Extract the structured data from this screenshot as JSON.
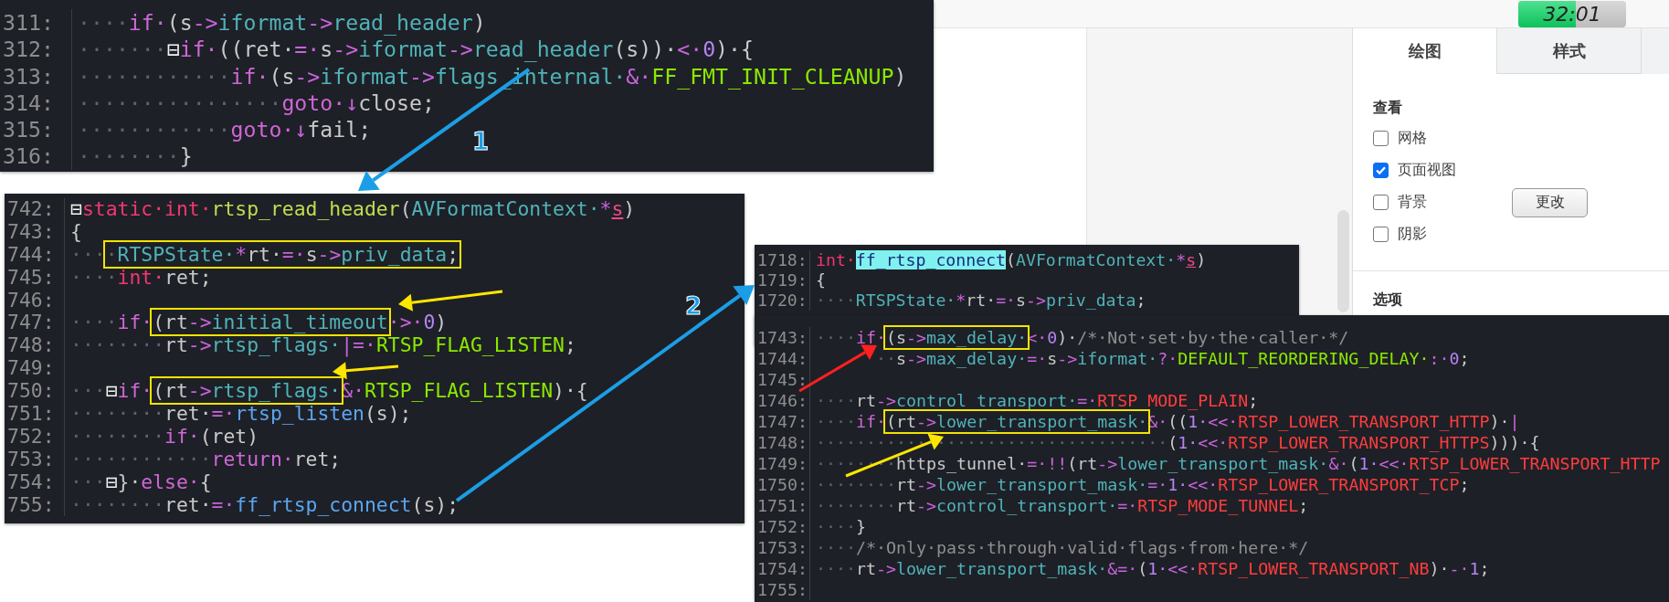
{
  "snippets": [
    {
      "lines": [
        {
          "number": "311:",
          "tokens": [
            {
              "kind": "ws",
              "text": "····"
            },
            {
              "kind": "keyword",
              "text": "if·"
            },
            {
              "kind": "plain",
              "text": "(s"
            },
            {
              "kind": "op",
              "text": "->"
            },
            {
              "kind": "member",
              "text": "iformat"
            },
            {
              "kind": "op",
              "text": "->"
            },
            {
              "kind": "member",
              "text": "read_header"
            },
            {
              "kind": "plain",
              "text": ")"
            }
          ]
        },
        {
          "number": "312:",
          "tokens": [
            {
              "kind": "ws",
              "text": "·······"
            },
            {
              "kind": "fold",
              "text": "⊟"
            },
            {
              "kind": "keyword",
              "text": "if·"
            },
            {
              "kind": "plain",
              "text": "((ret·"
            },
            {
              "kind": "op",
              "text": "=·"
            },
            {
              "kind": "plain",
              "text": "s"
            },
            {
              "kind": "op",
              "text": "->"
            },
            {
              "kind": "member",
              "text": "iformat"
            },
            {
              "kind": "op",
              "text": "->"
            },
            {
              "kind": "member",
              "text": "read_header"
            },
            {
              "kind": "plain",
              "text": "(s))·"
            },
            {
              "kind": "op",
              "text": "<·"
            },
            {
              "kind": "num",
              "text": "0"
            },
            {
              "kind": "plain",
              "text": ")·{"
            }
          ]
        },
        {
          "number": "313:",
          "tokens": [
            {
              "kind": "ws",
              "text": "············"
            },
            {
              "kind": "keyword",
              "text": "if·"
            },
            {
              "kind": "plain",
              "text": "(s"
            },
            {
              "kind": "op",
              "text": "->"
            },
            {
              "kind": "member",
              "text": "iformat"
            },
            {
              "kind": "op",
              "text": "->"
            },
            {
              "kind": "member",
              "text": "flags_internal·"
            },
            {
              "kind": "op",
              "text": "&·"
            },
            {
              "kind": "macro",
              "text": "FF_FMT_INIT_CLEANUP"
            },
            {
              "kind": "plain",
              "text": ")"
            }
          ]
        },
        {
          "number": "314:",
          "tokens": [
            {
              "kind": "ws",
              "text": "················"
            },
            {
              "kind": "keyword",
              "text": "goto·"
            },
            {
              "kind": "op",
              "text": "↓"
            },
            {
              "kind": "plain",
              "text": "close;"
            }
          ]
        },
        {
          "number": "315:",
          "tokens": [
            {
              "kind": "ws",
              "text": "············"
            },
            {
              "kind": "keyword",
              "text": "goto·"
            },
            {
              "kind": "op",
              "text": "↓"
            },
            {
              "kind": "plain",
              "text": "fail;"
            }
          ]
        },
        {
          "number": "316:",
          "tokens": [
            {
              "kind": "ws",
              "text": "········"
            },
            {
              "kind": "plain",
              "text": "}"
            }
          ]
        }
      ]
    },
    {
      "lines": [
        {
          "number": "742:",
          "tokens": [
            {
              "kind": "fold",
              "text": "⊟"
            },
            {
              "kind": "type",
              "text": "static·"
            },
            {
              "kind": "type",
              "text": "int·"
            },
            {
              "kind": "def",
              "text": "rtsp_read_header"
            },
            {
              "kind": "plain",
              "text": "("
            },
            {
              "kind": "member",
              "text": "AVFormatContext·"
            },
            {
              "kind": "op",
              "text": "*"
            },
            {
              "kind": "param",
              "text": "s"
            },
            {
              "kind": "plain",
              "text": ")"
            }
          ]
        },
        {
          "number": "743:",
          "tokens": [
            {
              "kind": "plain",
              "text": "{"
            }
          ]
        },
        {
          "number": "744:",
          "tokens": [
            {
              "kind": "ws",
              "text": "···"
            },
            {
              "kind": "box",
              "children": [
                {
                  "kind": "ws",
                  "text": "·"
                },
                {
                  "kind": "member",
                  "text": "RTSPState·"
                },
                {
                  "kind": "op",
                  "text": "*"
                },
                {
                  "kind": "plain",
                  "text": "rt·"
                },
                {
                  "kind": "op",
                  "text": "=·"
                },
                {
                  "kind": "plain",
                  "text": "s"
                },
                {
                  "kind": "op",
                  "text": "->"
                },
                {
                  "kind": "member",
                  "text": "priv_data"
                },
                {
                  "kind": "plain",
                  "text": ";"
                }
              ]
            }
          ]
        },
        {
          "number": "745:",
          "tokens": [
            {
              "kind": "ws",
              "text": "····"
            },
            {
              "kind": "type",
              "text": "int·"
            },
            {
              "kind": "plain",
              "text": "ret;"
            }
          ]
        },
        {
          "number": "746:"
        },
        {
          "number": "747:",
          "tokens": [
            {
              "kind": "ws",
              "text": "····"
            },
            {
              "kind": "keyword",
              "text": "if·"
            },
            {
              "kind": "box",
              "children": [
                {
                  "kind": "plain",
                  "text": "(rt"
                },
                {
                  "kind": "op",
                  "text": "->"
                },
                {
                  "kind": "member",
                  "text": "initial_timeout"
                }
              ]
            },
            {
              "kind": "op",
              "text": "·>·"
            },
            {
              "kind": "num",
              "text": "0"
            },
            {
              "kind": "plain",
              "text": ")"
            }
          ]
        },
        {
          "number": "748:",
          "tokens": [
            {
              "kind": "ws",
              "text": "········"
            },
            {
              "kind": "plain",
              "text": "rt"
            },
            {
              "kind": "op",
              "text": "->"
            },
            {
              "kind": "member",
              "text": "rtsp_flags·"
            },
            {
              "kind": "op",
              "text": "|=·"
            },
            {
              "kind": "macro",
              "text": "RTSP_FLAG_LISTEN"
            },
            {
              "kind": "plain",
              "text": ";"
            }
          ]
        },
        {
          "number": "749:"
        },
        {
          "number": "750:",
          "tokens": [
            {
              "kind": "ws",
              "text": "···"
            },
            {
              "kind": "fold",
              "text": "⊟"
            },
            {
              "kind": "keyword",
              "text": "if·"
            },
            {
              "kind": "box",
              "children": [
                {
                  "kind": "plain",
                  "text": "(rt"
                },
                {
                  "kind": "op",
                  "text": "->"
                },
                {
                  "kind": "member",
                  "text": "rtsp_flags·"
                }
              ]
            },
            {
              "kind": "op",
              "text": "&·"
            },
            {
              "kind": "macro",
              "text": "RTSP_FLAG_LISTEN"
            },
            {
              "kind": "plain",
              "text": ")·{"
            }
          ]
        },
        {
          "number": "751:",
          "tokens": [
            {
              "kind": "ws",
              "text": "········"
            },
            {
              "kind": "plain",
              "text": "ret·"
            },
            {
              "kind": "op",
              "text": "=·"
            },
            {
              "kind": "func",
              "text": "rtsp_listen"
            },
            {
              "kind": "plain",
              "text": "(s);"
            }
          ]
        },
        {
          "number": "752:",
          "tokens": [
            {
              "kind": "ws",
              "text": "········"
            },
            {
              "kind": "keyword",
              "text": "if·"
            },
            {
              "kind": "plain",
              "text": "(ret)"
            }
          ]
        },
        {
          "number": "753:",
          "tokens": [
            {
              "kind": "ws",
              "text": "············"
            },
            {
              "kind": "keyword",
              "text": "return·"
            },
            {
              "kind": "plain",
              "text": "ret;"
            }
          ]
        },
        {
          "number": "754:",
          "tokens": [
            {
              "kind": "ws",
              "text": "···"
            },
            {
              "kind": "fold",
              "text": "⊟"
            },
            {
              "kind": "plain",
              "text": "}·"
            },
            {
              "kind": "keyword",
              "text": "else·"
            },
            {
              "kind": "plain",
              "text": "{"
            }
          ]
        },
        {
          "number": "755:",
          "tokens": [
            {
              "kind": "ws",
              "text": "········"
            },
            {
              "kind": "plain",
              "text": "ret·"
            },
            {
              "kind": "op",
              "text": "=·"
            },
            {
              "kind": "func",
              "text": "ff_rtsp_connect"
            },
            {
              "kind": "plain",
              "text": "(s);"
            }
          ]
        }
      ]
    },
    {
      "lines": [
        {
          "number": "1718:",
          "tokens": [
            {
              "kind": "type",
              "text": "int·"
            },
            {
              "kind": "mark",
              "text": "ff_rtsp_connect"
            },
            {
              "kind": "plain",
              "text": "("
            },
            {
              "kind": "member",
              "text": "AVFormatContext·"
            },
            {
              "kind": "op",
              "text": "*"
            },
            {
              "kind": "param",
              "text": "s"
            },
            {
              "kind": "plain",
              "text": ")"
            }
          ]
        },
        {
          "number": "1719:",
          "tokens": [
            {
              "kind": "plain",
              "text": "{"
            }
          ]
        },
        {
          "number": "1720:",
          "tokens": [
            {
              "kind": "ws",
              "text": "····"
            },
            {
              "kind": "member",
              "text": "RTSPState·"
            },
            {
              "kind": "op",
              "text": "*"
            },
            {
              "kind": "plain",
              "text": "rt·"
            },
            {
              "kind": "op",
              "text": "=·"
            },
            {
              "kind": "plain",
              "text": "s"
            },
            {
              "kind": "op",
              "text": "->"
            },
            {
              "kind": "member",
              "text": "priv_data"
            },
            {
              "kind": "plain",
              "text": ";"
            }
          ]
        }
      ]
    },
    {
      "lines": [
        {
          "number": "1743:",
          "tokens": [
            {
              "kind": "ws",
              "text": "····"
            },
            {
              "kind": "keyword",
              "text": "if·"
            },
            {
              "kind": "box",
              "children": [
                {
                  "kind": "plain",
                  "text": "(s"
                },
                {
                  "kind": "op",
                  "text": "->"
                },
                {
                  "kind": "member",
                  "text": "max_delay·"
                }
              ]
            },
            {
              "kind": "op",
              "text": "<·"
            },
            {
              "kind": "num",
              "text": "0"
            },
            {
              "kind": "plain",
              "text": ")·"
            },
            {
              "kind": "comment",
              "text": "/*·Not·set·by·the·caller·*/"
            }
          ]
        },
        {
          "number": "1744:",
          "tokens": [
            {
              "kind": "indent"
            },
            {
              "kind": "ws",
              "text": "··"
            },
            {
              "kind": "plain",
              "text": "s"
            },
            {
              "kind": "op",
              "text": "->"
            },
            {
              "kind": "member",
              "text": "max_delay·"
            },
            {
              "kind": "op",
              "text": "=·"
            },
            {
              "kind": "plain",
              "text": "s"
            },
            {
              "kind": "op",
              "text": "->"
            },
            {
              "kind": "member",
              "text": "iformat·"
            },
            {
              "kind": "op",
              "text": "?·"
            },
            {
              "kind": "macro",
              "text": "DEFAULT_REORDERING_DELAY·"
            },
            {
              "kind": "op",
              "text": ":·"
            },
            {
              "kind": "num",
              "text": "0"
            },
            {
              "kind": "plain",
              "text": ";"
            }
          ]
        },
        {
          "number": "1745:"
        },
        {
          "number": "1746:",
          "tokens": [
            {
              "kind": "ws",
              "text": "····"
            },
            {
              "kind": "plain",
              "text": "rt"
            },
            {
              "kind": "op",
              "text": "->"
            },
            {
              "kind": "member",
              "text": "control_transport·"
            },
            {
              "kind": "op",
              "text": "=·"
            },
            {
              "kind": "const",
              "text": "RTSP_MODE_PLAIN"
            },
            {
              "kind": "plain",
              "text": ";"
            }
          ]
        },
        {
          "number": "1747:",
          "tokens": [
            {
              "kind": "ws",
              "text": "····"
            },
            {
              "kind": "keyword",
              "text": "if·"
            },
            {
              "kind": "box",
              "children": [
                {
                  "kind": "plain",
                  "text": "(rt"
                },
                {
                  "kind": "op",
                  "text": "->"
                },
                {
                  "kind": "member",
                  "text": "lower_transport_mask·"
                }
              ]
            },
            {
              "kind": "op",
              "text": "&·"
            },
            {
              "kind": "plain",
              "text": "(("
            },
            {
              "kind": "num",
              "text": "1·"
            },
            {
              "kind": "op",
              "text": "<<·"
            },
            {
              "kind": "const",
              "text": "RTSP_LOWER_TRANSPORT_HTTP"
            },
            {
              "kind": "plain",
              "text": ")·"
            },
            {
              "kind": "op",
              "text": "|"
            }
          ]
        },
        {
          "number": "1748:",
          "tokens": [
            {
              "kind": "ws",
              "text": "···································"
            },
            {
              "kind": "plain",
              "text": "("
            },
            {
              "kind": "num",
              "text": "1·"
            },
            {
              "kind": "op",
              "text": "<<·"
            },
            {
              "kind": "const",
              "text": "RTSP_LOWER_TRANSPORT_HTTPS"
            },
            {
              "kind": "plain",
              "text": ")))·{"
            }
          ]
        },
        {
          "number": "1749:",
          "tokens": [
            {
              "kind": "ws",
              "text": "········"
            },
            {
              "kind": "plain",
              "text": "https_tunnel·"
            },
            {
              "kind": "op",
              "text": "=·!!"
            },
            {
              "kind": "plain",
              "text": "(rt"
            },
            {
              "kind": "op",
              "text": "->"
            },
            {
              "kind": "member",
              "text": "lower_transport_mask·"
            },
            {
              "kind": "op",
              "text": "&·"
            },
            {
              "kind": "plain",
              "text": "("
            },
            {
              "kind": "num",
              "text": "1·"
            },
            {
              "kind": "op",
              "text": "<<·"
            },
            {
              "kind": "const",
              "text": "RTSP_LOWER_TRANSPORT_HTTP"
            }
          ]
        },
        {
          "number": "1750:",
          "tokens": [
            {
              "kind": "ws",
              "text": "········"
            },
            {
              "kind": "plain",
              "text": "rt"
            },
            {
              "kind": "op",
              "text": "->"
            },
            {
              "kind": "member",
              "text": "lower_transport_mask·"
            },
            {
              "kind": "op",
              "text": "=·"
            },
            {
              "kind": "num",
              "text": "1·"
            },
            {
              "kind": "op",
              "text": "<<·"
            },
            {
              "kind": "const",
              "text": "RTSP_LOWER_TRANSPORT_TCP"
            },
            {
              "kind": "plain",
              "text": ";"
            }
          ]
        },
        {
          "number": "1751:",
          "tokens": [
            {
              "kind": "ws",
              "text": "········"
            },
            {
              "kind": "plain",
              "text": "rt"
            },
            {
              "kind": "op",
              "text": "->"
            },
            {
              "kind": "member",
              "text": "control_transport·"
            },
            {
              "kind": "op",
              "text": "=·"
            },
            {
              "kind": "const",
              "text": "RTSP_MODE_TUNNEL"
            },
            {
              "kind": "plain",
              "text": ";"
            }
          ]
        },
        {
          "number": "1752:",
          "tokens": [
            {
              "kind": "ws",
              "text": "····"
            },
            {
              "kind": "plain",
              "text": "}"
            }
          ]
        },
        {
          "number": "1753:",
          "tokens": [
            {
              "kind": "ws",
              "text": "····"
            },
            {
              "kind": "comment",
              "text": "/*·Only·pass·through·valid·flags·from·here·*/"
            }
          ]
        },
        {
          "number": "1754:",
          "tokens": [
            {
              "kind": "ws",
              "text": "····"
            },
            {
              "kind": "plain",
              "text": "rt"
            },
            {
              "kind": "op",
              "text": "->"
            },
            {
              "kind": "member",
              "text": "lower_transport_mask·"
            },
            {
              "kind": "op",
              "text": "&=·"
            },
            {
              "kind": "plain",
              "text": "("
            },
            {
              "kind": "num",
              "text": "1·"
            },
            {
              "kind": "op",
              "text": "<<·"
            },
            {
              "kind": "const",
              "text": "RTSP_LOWER_TRANSPORT_NB"
            },
            {
              "kind": "plain",
              "text": ")·"
            },
            {
              "kind": "op",
              "text": "-·"
            },
            {
              "kind": "num",
              "text": "1"
            },
            {
              "kind": "plain",
              "text": ";"
            }
          ]
        },
        {
          "number": "1755:"
        }
      ]
    }
  ],
  "arrows": [
    {
      "color": "#1b9ee6",
      "label": "1"
    },
    {
      "color": "#1b9ee6",
      "label": "2"
    },
    {
      "color": "#ffe600"
    },
    {
      "color": "#ffe600"
    },
    {
      "color": "#ff2020"
    },
    {
      "color": "#ffe600"
    }
  ],
  "timer": {
    "text": "32:01",
    "level": 0.53
  },
  "panel": {
    "tabs": [
      {
        "label": "绘图",
        "selected": true
      },
      {
        "label": "样式",
        "selected": false
      }
    ],
    "sections": [
      {
        "title": "查看",
        "options": [
          {
            "label": "网格",
            "checked": false
          },
          {
            "label": "页面视图",
            "checked": true
          },
          {
            "label": "背景",
            "checked": false,
            "button": "更改"
          },
          {
            "label": "阴影",
            "checked": false
          }
        ]
      },
      {
        "title": "选项"
      }
    ]
  }
}
